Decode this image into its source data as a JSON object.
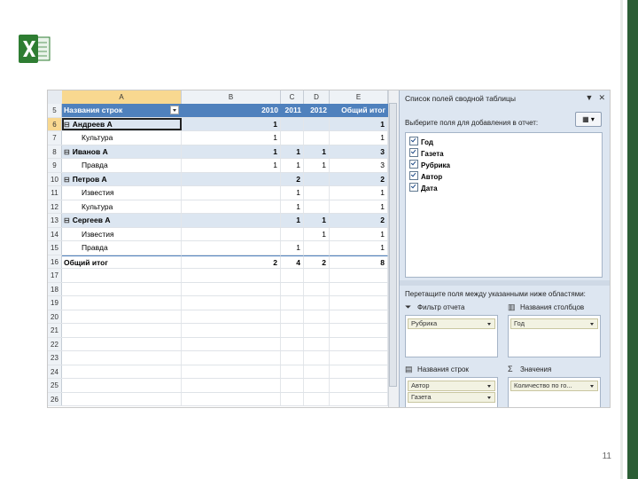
{
  "slide": {
    "page_number": "11"
  },
  "icons": {
    "excel_logo": "excel-logo-icon"
  },
  "sheet": {
    "columns": [
      "A",
      "B",
      "C",
      "D",
      "E"
    ],
    "header_row": {
      "row": "5",
      "cells": [
        "Названия строк",
        "2010",
        "2011",
        "2012",
        "Общий итог"
      ]
    },
    "rows": [
      {
        "row": "6",
        "type": "group",
        "cells": [
          "Андреев А",
          "1",
          "",
          "",
          "1"
        ]
      },
      {
        "row": "7",
        "type": "item",
        "cells": [
          "Культура",
          "1",
          "",
          "",
          "1"
        ]
      },
      {
        "row": "8",
        "type": "group",
        "cells": [
          "Иванов А",
          "1",
          "1",
          "1",
          "3"
        ]
      },
      {
        "row": "9",
        "type": "item",
        "cells": [
          "Правда",
          "1",
          "1",
          "1",
          "3"
        ]
      },
      {
        "row": "10",
        "type": "group",
        "cells": [
          "Петров А",
          "",
          "2",
          "",
          "2"
        ]
      },
      {
        "row": "11",
        "type": "item",
        "cells": [
          "Известия",
          "",
          "1",
          "",
          "1"
        ]
      },
      {
        "row": "12",
        "type": "item",
        "cells": [
          "Культура",
          "",
          "1",
          "",
          "1"
        ]
      },
      {
        "row": "13",
        "type": "group",
        "cells": [
          "Сергеев А",
          "",
          "1",
          "1",
          "2"
        ]
      },
      {
        "row": "14",
        "type": "item",
        "cells": [
          "Известия",
          "",
          "",
          "1",
          "1"
        ]
      },
      {
        "row": "15",
        "type": "item",
        "cells": [
          "Правда",
          "",
          "1",
          "",
          "1"
        ]
      },
      {
        "row": "16",
        "type": "total",
        "cells": [
          "Общий итог",
          "2",
          "4",
          "2",
          "8"
        ]
      },
      {
        "row": "17",
        "type": "empty",
        "cells": [
          "",
          "",
          "",
          "",
          ""
        ]
      },
      {
        "row": "18",
        "type": "empty",
        "cells": [
          "",
          "",
          "",
          "",
          ""
        ]
      },
      {
        "row": "19",
        "type": "empty",
        "cells": [
          "",
          "",
          "",
          "",
          ""
        ]
      },
      {
        "row": "20",
        "type": "empty",
        "cells": [
          "",
          "",
          "",
          "",
          ""
        ]
      },
      {
        "row": "21",
        "type": "empty",
        "cells": [
          "",
          "",
          "",
          "",
          ""
        ]
      },
      {
        "row": "22",
        "type": "empty",
        "cells": [
          "",
          "",
          "",
          "",
          ""
        ]
      },
      {
        "row": "23",
        "type": "empty",
        "cells": [
          "",
          "",
          "",
          "",
          ""
        ]
      },
      {
        "row": "24",
        "type": "empty",
        "cells": [
          "",
          "",
          "",
          "",
          ""
        ]
      },
      {
        "row": "25",
        "type": "empty",
        "cells": [
          "",
          "",
          "",
          "",
          ""
        ]
      },
      {
        "row": "26",
        "type": "empty",
        "cells": [
          "",
          "",
          "",
          "",
          ""
        ]
      }
    ]
  },
  "pivot_panel": {
    "title": "Список полей сводной таблицы",
    "choose_label": "Выберите поля для добавления в отчет:",
    "fields": [
      "Год",
      "Газета",
      "Рубрика",
      "Автор",
      "Дата"
    ],
    "drag_label": "Перетащите поля между указанными ниже областями:",
    "zones": {
      "report_filter": {
        "label": "Фильтр отчета",
        "items": [
          "Рубрика"
        ]
      },
      "column_labels": {
        "label": "Названия столбцов",
        "items": [
          "Год"
        ]
      },
      "row_labels": {
        "label": "Названия строк",
        "items": [
          "Автор",
          "Газета"
        ]
      },
      "values": {
        "label": "Значения",
        "items": [
          "Количество по го..."
        ]
      }
    }
  },
  "colors": {
    "pivot_header": "#4f81bd",
    "group_row": "#dce6f1",
    "panel_bg": "#dde6f1",
    "slide_accent": "#2b5e35"
  }
}
